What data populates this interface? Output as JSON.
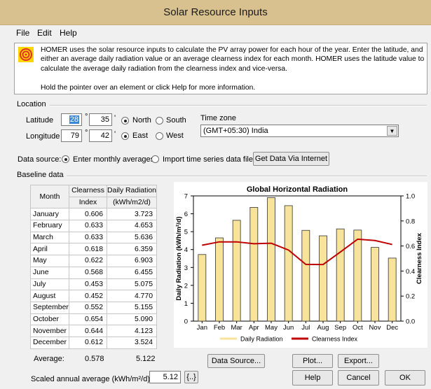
{
  "window": {
    "title": "Solar Resource Inputs"
  },
  "menu": [
    "File",
    "Edit",
    "Help"
  ],
  "info": {
    "paragraph": "HOMER uses the solar resource inputs to calculate the PV array power for each hour of the year. Enter the latitude, and either an average daily radiation value or an average clearness index for each month. HOMER uses the latitude value to calculate the average daily radiation from the clearness index and vice-versa.",
    "hint": "Hold the pointer over an element or click Help for more information."
  },
  "location": {
    "section_label": "Location",
    "latitude_label": "Latitude",
    "latitude_deg": "28",
    "latitude_min": "35",
    "north_label": "North",
    "south_label": "South",
    "longitude_label": "Longitude",
    "longitude_deg": "79",
    "longitude_min": "42",
    "east_label": "East",
    "west_label": "West",
    "degree_symbol": "°",
    "minute_symbol": "'",
    "timezone_label": "Time zone",
    "timezone_value": "(GMT+05:30) India"
  },
  "data_source": {
    "label": "Data source:",
    "option_monthly": "Enter monthly averages",
    "option_import": "Import time series data file",
    "internet_button": "Get Data Via Internet"
  },
  "baseline": {
    "section_label": "Baseline data",
    "col_month": "Month",
    "col_clearness_1": "Clearness",
    "col_clearness_2": "Index",
    "col_radiation_1": "Daily Radiation",
    "col_radiation_2": "(kWh/m2/d)",
    "rows": [
      {
        "month": "January",
        "clearness": "0.606",
        "radiation": "3.723"
      },
      {
        "month": "February",
        "clearness": "0.633",
        "radiation": "4.653"
      },
      {
        "month": "March",
        "clearness": "0.633",
        "radiation": "5.636"
      },
      {
        "month": "April",
        "clearness": "0.618",
        "radiation": "6.359"
      },
      {
        "month": "May",
        "clearness": "0.622",
        "radiation": "6.903"
      },
      {
        "month": "June",
        "clearness": "0.568",
        "radiation": "6.455"
      },
      {
        "month": "July",
        "clearness": "0.453",
        "radiation": "5.075"
      },
      {
        "month": "August",
        "clearness": "0.452",
        "radiation": "4.770"
      },
      {
        "month": "September",
        "clearness": "0.552",
        "radiation": "5.155"
      },
      {
        "month": "October",
        "clearness": "0.654",
        "radiation": "5.090"
      },
      {
        "month": "November",
        "clearness": "0.644",
        "radiation": "4.123"
      },
      {
        "month": "December",
        "clearness": "0.612",
        "radiation": "3.524"
      }
    ],
    "average_label": "Average:",
    "average_clearness": "0.578",
    "average_radiation": "5.122"
  },
  "scaled": {
    "label": "Scaled annual average (kWh/m²/d)",
    "value": "5.12",
    "button": "{..}"
  },
  "buttons": {
    "data_source": "Data Source...",
    "plot": "Plot...",
    "export": "Export...",
    "help": "Help",
    "cancel": "Cancel",
    "ok": "OK"
  },
  "chart_data": {
    "type": "bar",
    "title": "Global Horizontal Radiation",
    "categories": [
      "Jan",
      "Feb",
      "Mar",
      "Apr",
      "May",
      "Jun",
      "Jul",
      "Aug",
      "Sep",
      "Oct",
      "Nov",
      "Dec"
    ],
    "series": [
      {
        "name": "Daily Radiation",
        "type": "bar",
        "axis": "left",
        "color": "#f7e39a",
        "values": [
          3.723,
          4.653,
          5.636,
          6.359,
          6.903,
          6.455,
          5.075,
          4.77,
          5.155,
          5.09,
          4.123,
          3.524
        ]
      },
      {
        "name": "Clearness Index",
        "type": "line",
        "axis": "right",
        "color": "#c00000",
        "values": [
          0.606,
          0.633,
          0.633,
          0.618,
          0.622,
          0.568,
          0.453,
          0.452,
          0.552,
          0.654,
          0.644,
          0.612
        ]
      }
    ],
    "ylabel": "Daily Radiation (kWh/m²/d)",
    "ylim": [
      0,
      7
    ],
    "yticks": [
      "0",
      "1",
      "2",
      "3",
      "4",
      "5",
      "6",
      "7"
    ],
    "y2label": "Clearness Index",
    "y2lim": [
      0,
      1
    ],
    "y2ticks": [
      "0.0",
      "0.2",
      "0.4",
      "0.6",
      "0.8",
      "1.0"
    ],
    "grid": false,
    "legend": "bottom"
  }
}
